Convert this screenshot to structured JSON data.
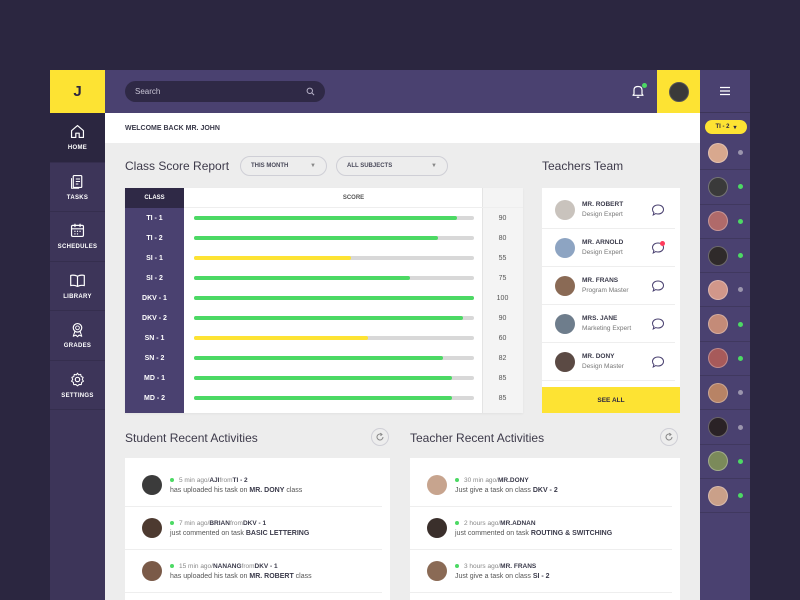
{
  "logo": "J",
  "search": {
    "placeholder": "Search"
  },
  "nav": [
    {
      "label": "HOME",
      "icon": "home-icon",
      "active": true
    },
    {
      "label": "TASKS",
      "icon": "tasks-icon"
    },
    {
      "label": "SCHEDULES",
      "icon": "calendar-icon"
    },
    {
      "label": "LIBRARY",
      "icon": "book-icon"
    },
    {
      "label": "GRADES",
      "icon": "award-icon"
    },
    {
      "label": "SETTINGS",
      "icon": "gear-icon"
    }
  ],
  "welcome": "WELCOME BACK MR. JOHN",
  "score_report": {
    "title": "Class Score Report",
    "filter_month": "THIS MONTH",
    "filter_subject": "ALL SUBJECTS",
    "col_class": "CLASS",
    "col_score": "SCORE",
    "rows": [
      {
        "cls": "TI - 1",
        "score": "90",
        "level": 0.94,
        "color": "#4cd964"
      },
      {
        "cls": "TI - 2",
        "score": "80",
        "level": 0.87,
        "color": "#4cd964"
      },
      {
        "cls": "SI - 1",
        "score": "55",
        "level": 0.56,
        "color": "#fde333"
      },
      {
        "cls": "SI - 2",
        "score": "75",
        "level": 0.77,
        "color": "#4cd964"
      },
      {
        "cls": "DKV - 1",
        "score": "100",
        "level": 1.0,
        "color": "#4cd964"
      },
      {
        "cls": "DKV - 2",
        "score": "90",
        "level": 0.96,
        "color": "#4cd964"
      },
      {
        "cls": "SN - 1",
        "score": "60",
        "level": 0.62,
        "color": "#fde333"
      },
      {
        "cls": "SN - 2",
        "score": "82",
        "level": 0.89,
        "color": "#4cd964"
      },
      {
        "cls": "MD - 1",
        "score": "85",
        "level": 0.92,
        "color": "#4cd964"
      },
      {
        "cls": "MD - 2",
        "score": "85",
        "level": 0.92,
        "color": "#4cd964"
      }
    ]
  },
  "team": {
    "title": "Teachers Team",
    "see_all": "SEE ALL",
    "members": [
      {
        "name": "MR. ROBERT",
        "role": "Design Expert",
        "avatar": "#c9c3bd",
        "unread": false
      },
      {
        "name": "MR. ARNOLD",
        "role": "Design Expert",
        "avatar": "#8da4c2",
        "unread": true
      },
      {
        "name": "MR. FRANS",
        "role": "Program Master",
        "avatar": "#8a6a55",
        "unread": false
      },
      {
        "name": "MRS. JANE",
        "role": "Marketing Expert",
        "avatar": "#6e7d8c",
        "unread": false
      },
      {
        "name": "MR. DONY",
        "role": "Design Master",
        "avatar": "#5b4a44",
        "unread": false
      }
    ]
  },
  "student_activities": {
    "title": "Student Recent Activities",
    "items": [
      {
        "time": "5 min ago",
        "sep1": " / ",
        "who": "AJI",
        "from_word": " from ",
        "where": "TI - 2",
        "text": "has uploaded his task on ",
        "target": "MR. DONY",
        "suffix": " class",
        "avatar": "#3b3b3b"
      },
      {
        "time": "7 min ago",
        "sep1": " / ",
        "who": "BRIAN",
        "from_word": " from ",
        "where": "DKV - 1",
        "text": "just commented on task ",
        "target": "BASIC LETTERING",
        "suffix": "",
        "avatar": "#4d3a30"
      },
      {
        "time": "15 min ago",
        "sep1": " / ",
        "who": "NANANG",
        "from_word": " from ",
        "where": "DKV - 1",
        "text": "has uploaded his task on ",
        "target": "MR. ROBERT",
        "suffix": " class",
        "avatar": "#7a5a48"
      }
    ]
  },
  "teacher_activities": {
    "title": "Teacher Recent Activities",
    "items": [
      {
        "time": "30 min ago",
        "sep1": " / ",
        "who": "MR.DONY",
        "from_word": "",
        "where": "",
        "text": "Just give a task on class ",
        "target": "DKV - 2",
        "suffix": "",
        "avatar": "#c7a48e"
      },
      {
        "time": "2 hours ago",
        "sep1": " / ",
        "who": "MR.ADNAN",
        "from_word": "",
        "where": "",
        "text": "just commented on task ",
        "target": "ROUTING & SWITCHING",
        "suffix": "",
        "avatar": "#3a2f2b"
      },
      {
        "time": "3 hours ago",
        "sep1": " / ",
        "who": "MR. FRANS",
        "from_word": "",
        "where": "",
        "text": "Just give a task on class ",
        "target": "SI - 2",
        "suffix": "",
        "avatar": "#8a6a55"
      }
    ]
  },
  "right_panel": {
    "class_tag": "TI - 2",
    "contacts": [
      {
        "avatar": "#d8a88e",
        "online": false
      },
      {
        "avatar": "#3a3a3a",
        "online": true
      },
      {
        "avatar": "#b06a6a",
        "online": true
      },
      {
        "avatar": "#2f2a2a",
        "online": true
      },
      {
        "avatar": "#d1978a",
        "online": false
      },
      {
        "avatar": "#c48b78",
        "online": true
      },
      {
        "avatar": "#a75a5a",
        "online": true
      },
      {
        "avatar": "#b88365",
        "online": false
      },
      {
        "avatar": "#2a2226",
        "online": false
      },
      {
        "avatar": "#7b8a5a",
        "online": true
      },
      {
        "avatar": "#caa089",
        "online": true
      }
    ]
  },
  "colors": {
    "primary": "#4a4170",
    "accent": "#fde333",
    "online": "#4cd964",
    "offline": "#9b95ad",
    "unread": "#ff3b5c"
  }
}
